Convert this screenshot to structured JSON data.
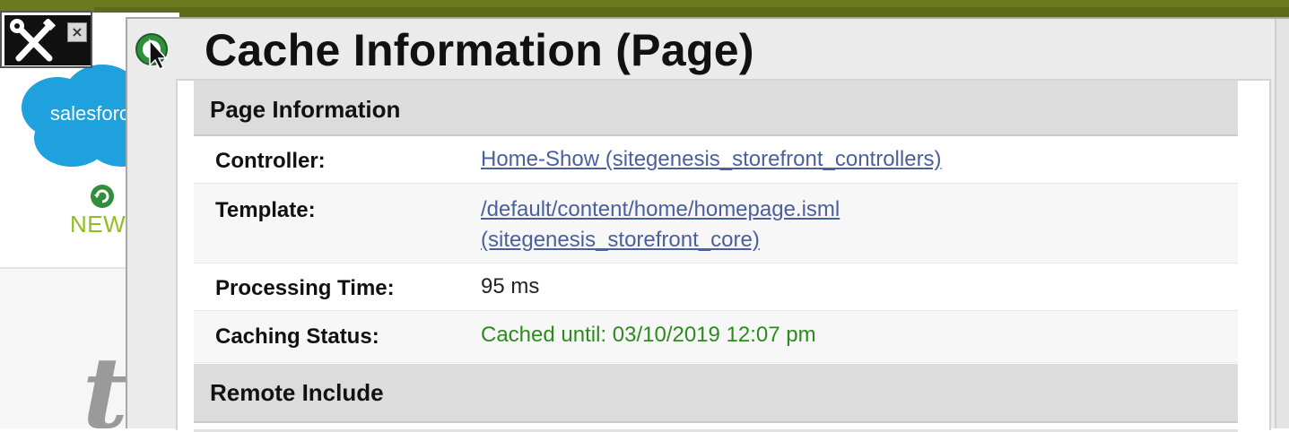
{
  "background_page": {
    "logo_text": "salesforce",
    "new_arrivals_label": "NEW AR",
    "big_text": "th"
  },
  "toolbox": {
    "tools_icon": "wrench-screwdriver-icon",
    "close_label": "×"
  },
  "popup": {
    "icon": "cursor-globe-icon",
    "title": "Cache Information (Page)",
    "sections": {
      "page_info": {
        "heading": "Page Information",
        "rows": [
          {
            "label": "Controller:",
            "value": "Home-Show (sitegenesis_storefront_controllers)"
          },
          {
            "label": "Template:",
            "value_line1": "/default/content/home/homepage.isml",
            "value_line2": "(sitegenesis_storefront_core)"
          },
          {
            "label": "Processing Time:",
            "value": "95 ms"
          },
          {
            "label": "Caching Status:",
            "value": "Cached until: 03/10/2019 12:07 pm"
          }
        ]
      },
      "remote_include": {
        "heading": "Remote Include"
      }
    }
  },
  "colors": {
    "olive": "#6b7a1e",
    "link": "#4a5f9e",
    "status_green": "#2e8a1f",
    "salesforce_blue": "#1ea1dd",
    "new_arrivals_green": "#8fbf22"
  }
}
